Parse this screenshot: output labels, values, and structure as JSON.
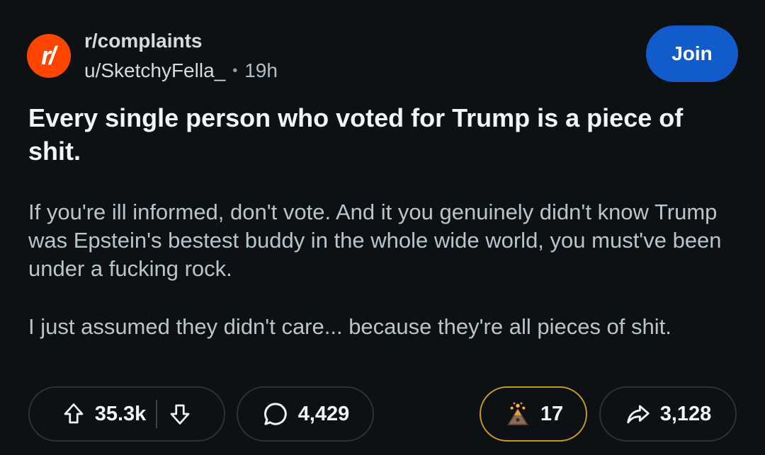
{
  "post": {
    "avatar_text": "r/",
    "subreddit": "r/complaints",
    "author": "u/SketchyFella_",
    "separator": "•",
    "time": "19h",
    "join_label": "Join",
    "title": "Every single person who voted for Trump is a piece of shit.",
    "body": [
      "If you're ill informed, don't vote. And it you genuinely didn't know Trump was Epstein's bestest buddy in the whole wide world, you must've been under a fucking rock.",
      "I just assumed they didn't care... because they're all pieces of shit."
    ]
  },
  "actions": {
    "upvotes": "35.3k",
    "comments": "4,429",
    "awards": "17",
    "shares": "3,128"
  },
  "icons": [
    "upvote-icon",
    "downvote-icon",
    "comment-icon",
    "award-icon",
    "share-icon"
  ],
  "colors": {
    "background": "#0e1113",
    "join_button": "#115bca",
    "avatar": "#ff4500",
    "award_border": "#c99a1b"
  }
}
